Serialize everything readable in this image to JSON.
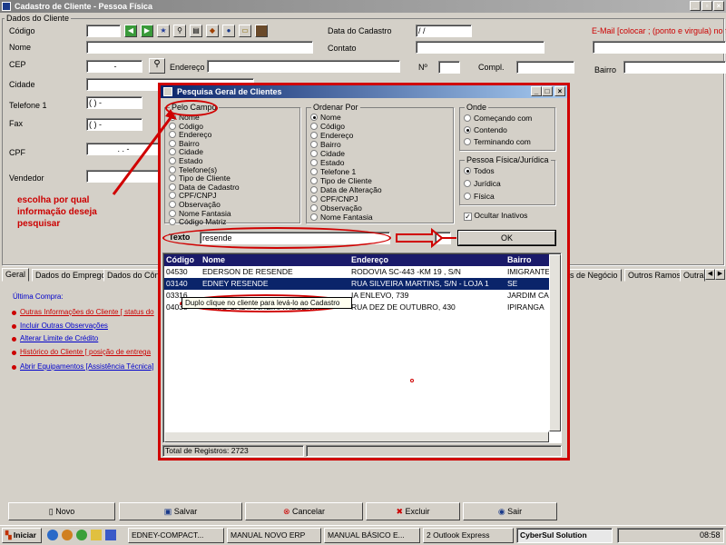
{
  "window": {
    "title": "Cadastro de Cliente - Pessoa Física"
  },
  "form": {
    "group_title": "Dados do Cliente",
    "codigo_label": "Código",
    "nome_label": "Nome",
    "cep_label": "CEP",
    "cidade_label": "Cidade",
    "telefone_label": "Telefone 1",
    "fax_label": "Fax",
    "cpf_label": "CPF",
    "vendedor_label": "Vendedor",
    "data_cadastro_label": "Data do Cadastro",
    "data_cadastro_value": "/ /",
    "contato_label": "Contato",
    "endereco_label": "Endereço",
    "numero_label": "Nº",
    "compl_label": "Compl.",
    "bairro_label": "Bairro",
    "email_label": "E-Mail [colocar ; (ponto e virgula) no final",
    "cep_mask": "-",
    "telefone_mask": "( )   -",
    "fax_mask": "( )   -",
    "cpf_mask": ".   .   -"
  },
  "tabs": [
    "Geral",
    "Dados do Emprego",
    "Dados do Côn",
    "s de Negócio",
    "Outros Ramos",
    "Outra"
  ],
  "links": {
    "ultima_compra": "Última Compra:",
    "items": [
      "Outras Informações do Cliente [ status do",
      "Incluir Outras Observações",
      "Alterar Limite de Crédito",
      "Histórico do Cliente [ posição de entrega",
      "Abrir Equipamentos [Assistência Técnica]"
    ]
  },
  "dialog": {
    "title": "Pesquisa Geral de Clientes",
    "pelo_campo": {
      "title": "Pelo Campo",
      "options": [
        "Nome",
        "Código",
        "Endereço",
        "Bairro",
        "Cidade",
        "Estado",
        "Telefone(s)",
        "Tipo de Cliente",
        "Data de Cadastro",
        "CPF/CNPJ",
        "Observação",
        "Nome Fantasia",
        "Código Matriz"
      ],
      "selected": 0
    },
    "ordenar_por": {
      "title": "Ordenar Por",
      "options": [
        "Nome",
        "Código",
        "Endereço",
        "Bairro",
        "Cidade",
        "Estado",
        "Telefone 1",
        "Tipo de Cliente",
        "Data de Alteração",
        "CPF/CNPJ",
        "Observação",
        "Nome Fantasia"
      ],
      "selected": 0
    },
    "onde": {
      "title": "Onde",
      "options": [
        "Começando com",
        "Contendo",
        "Terminando com"
      ],
      "selected": 1
    },
    "pessoa": {
      "title": "Pessoa Física/Jurídica",
      "options": [
        "Todos",
        "Jurídica",
        "Física"
      ],
      "selected": 0
    },
    "ocultar_inativos": "Ocultar Inativos",
    "texto_label": "Texto",
    "texto_value": "resende",
    "ok_label": "OK",
    "columns": [
      "Código",
      "Nome",
      "Endereço",
      "Bairro"
    ],
    "rows": [
      {
        "codigo": "04530",
        "nome": "EDERSON DE RESENDE",
        "endereco": "RODOVIA SC-443 -KM 19 , S/N",
        "bairro": "IMIGRANTE"
      },
      {
        "codigo": "03140",
        "nome": "EDNEY RESENDE",
        "endereco": "RUA SILVEIRA MARTINS, S/N - LOJA 1",
        "bairro": "SE"
      },
      {
        "codigo": "03316",
        "nome": "",
        "endereco": "IA ENLEVO, 739",
        "bairro": "JARDIM CA"
      },
      {
        "codigo": "04038",
        "nome": "PABLO CASTANHEIRA RESENDE",
        "endereco": "RUA DEZ DE OUTUBRO, 430",
        "bairro": "IPIRANGA"
      }
    ],
    "selected_row": 1,
    "total": "Total de Registros: 2723"
  },
  "annotations": {
    "escolha": [
      "escolha por qual",
      "informação deseja",
      "pesquisar"
    ],
    "duplo": "Duplo clique no cliente para levá-lo ao Cadastro"
  },
  "buttons": {
    "novo": "Novo",
    "salvar": "Salvar",
    "cancelar": "Cancelar",
    "excluir": "Excluir",
    "sair": "Sair"
  },
  "taskbar": {
    "start": "Iniciar",
    "items": [
      "EDNEY-COMPACT...",
      "MANUAL NOVO ERP",
      "MANUAL BÁSICO E...",
      "2 Outlook Express",
      "CyberSul Solution"
    ],
    "clock": "08:58"
  },
  "colors": {
    "accent_red": "#d00000",
    "selection": "#0a246a",
    "title_active": "#0a246a"
  }
}
